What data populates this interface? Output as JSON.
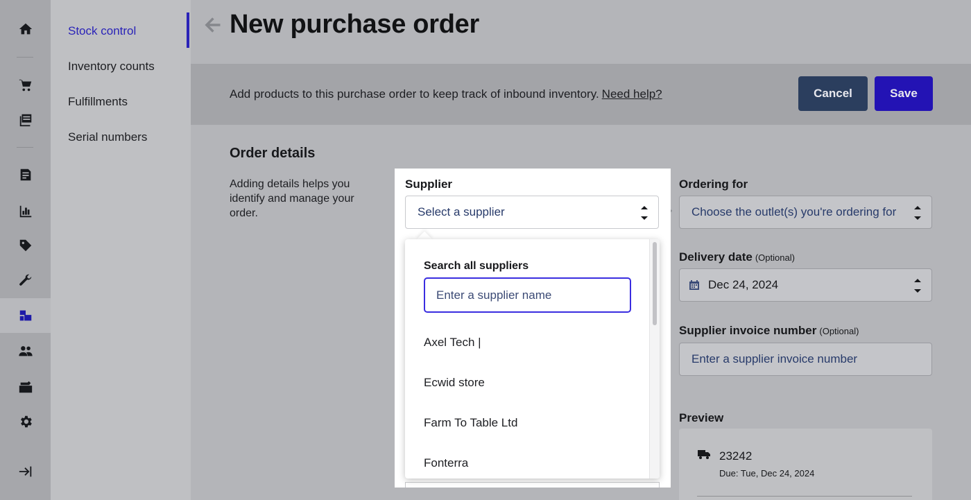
{
  "rail": {
    "icons": [
      "home-icon",
      "cart-icon",
      "catalog-icon",
      "reports-icon",
      "chart-icon",
      "tag-icon",
      "wrench-icon",
      "inventory-icon",
      "customers-icon",
      "cash-drawer-icon",
      "gear-icon",
      "expand-sidebar-icon"
    ]
  },
  "subnav": {
    "items": [
      {
        "label": "Stock control",
        "active": true
      },
      {
        "label": "Inventory counts"
      },
      {
        "label": "Fulfillments"
      },
      {
        "label": "Serial numbers"
      }
    ]
  },
  "header": {
    "title": "New purchase order"
  },
  "banner": {
    "text": "Add products to this purchase order to keep track of inbound inventory.",
    "help_link": "Need help?",
    "cancel_label": "Cancel",
    "save_label": "Save"
  },
  "details": {
    "title": "Order details",
    "description": "Adding details helps you identify and manage your order."
  },
  "supplier": {
    "label": "Supplier",
    "placeholder": "Select a supplier",
    "dropdown": {
      "title": "Search all suppliers",
      "search_placeholder": "Enter a supplier name",
      "options": [
        "Axel Tech |",
        "Ecwid store",
        "Farm To Table Ltd",
        "Fonterra"
      ]
    }
  },
  "ordering_for": {
    "label": "Ordering for",
    "placeholder": "Choose the outlet(s) you're ordering for"
  },
  "delivery_date": {
    "label": "Delivery date",
    "optional": "(Optional)",
    "value": "Dec 24, 2024"
  },
  "invoice": {
    "label": "Supplier invoice number",
    "optional": "(Optional)",
    "placeholder": "Enter a supplier invoice number"
  },
  "preview": {
    "label": "Preview",
    "order_number": "23242",
    "due": "Due: Tue, Dec 24, 2024"
  },
  "colors": {
    "accent": "#2a23b8",
    "save_button": "#2313b4",
    "cancel_button": "#2b3e5e"
  }
}
